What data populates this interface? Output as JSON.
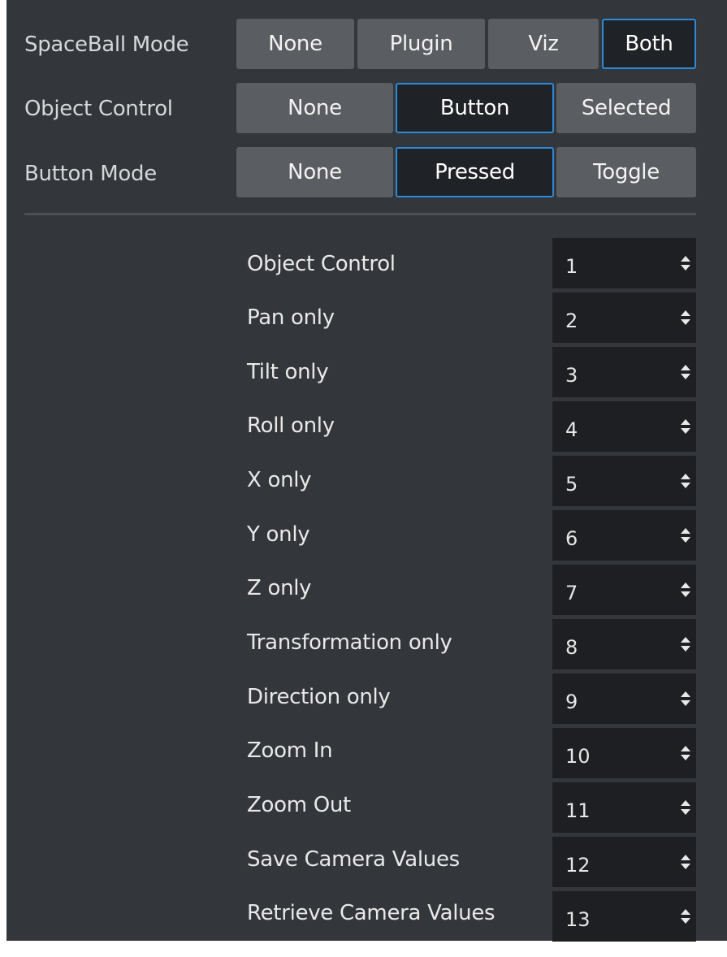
{
  "modes": [
    {
      "label": "SpaceBall Mode",
      "options": [
        "None",
        "Plugin",
        "Viz",
        "Both"
      ],
      "selected": "Both"
    },
    {
      "label": "Object Control",
      "options": [
        "None",
        "Button",
        "Selected"
      ],
      "selected": "Button"
    },
    {
      "label": "Button Mode",
      "options": [
        "None",
        "Pressed",
        "Toggle"
      ],
      "selected": "Pressed"
    }
  ],
  "mappings": [
    {
      "label": "Object Control",
      "value": "1"
    },
    {
      "label": "Pan only",
      "value": "2"
    },
    {
      "label": "Tilt only",
      "value": "3"
    },
    {
      "label": "Roll only",
      "value": "4"
    },
    {
      "label": "X only",
      "value": "5"
    },
    {
      "label": "Y only",
      "value": "6"
    },
    {
      "label": "Z only",
      "value": "7"
    },
    {
      "label": "Transformation only",
      "value": "8"
    },
    {
      "label": "Direction only",
      "value": "9"
    },
    {
      "label": "Zoom In",
      "value": "10"
    },
    {
      "label": "Zoom Out",
      "value": "11"
    },
    {
      "label": "Save Camera Values",
      "value": "12"
    },
    {
      "label": "Retrieve Camera Values",
      "value": "13"
    }
  ],
  "icons": {
    "spinner": "up-down-arrows-icon"
  },
  "colors": {
    "panel_bg": "#33363b",
    "button_bg": "#5a5d62",
    "active_bg": "#1f2226",
    "active_border": "#2d8ad8",
    "field_bg": "#1d1f22"
  }
}
